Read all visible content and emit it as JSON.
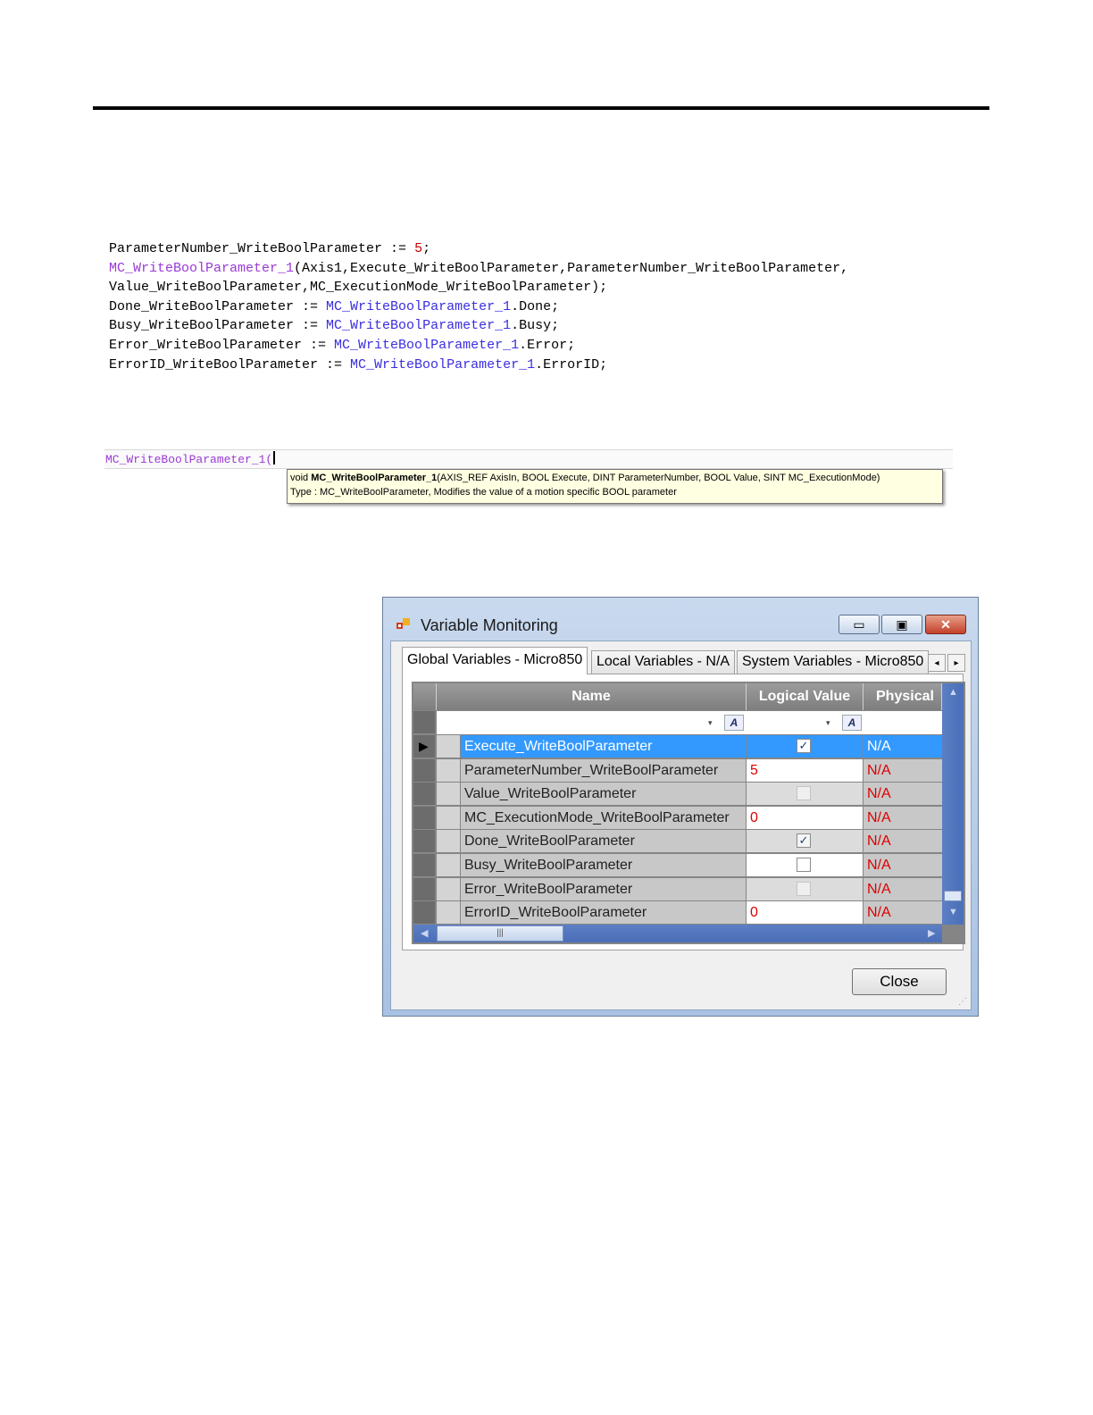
{
  "code": {
    "lines": [
      [
        {
          "t": "ParameterNumber_WriteBoolParameter := ",
          "c": ""
        },
        {
          "t": "5",
          "c": "red"
        },
        {
          "t": ";",
          "c": ""
        }
      ],
      [
        {
          "t": "MC_WriteBoolParameter_1",
          "c": "purple"
        },
        {
          "t": "(Axis1,Execute_WriteBoolParameter,ParameterNumber_WriteBoolParameter,",
          "c": ""
        }
      ],
      [
        {
          "t": "Value_WriteBoolParameter,MC_ExecutionMode_WriteBoolParameter);",
          "c": ""
        }
      ],
      [
        {
          "t": "Done_WriteBoolParameter := ",
          "c": ""
        },
        {
          "t": "MC_WriteBoolParameter_1",
          "c": "blue"
        },
        {
          "t": ".Done;",
          "c": ""
        }
      ],
      [
        {
          "t": "Busy_WriteBoolParameter := ",
          "c": ""
        },
        {
          "t": "MC_WriteBoolParameter_1",
          "c": "blue"
        },
        {
          "t": ".Busy;",
          "c": ""
        }
      ],
      [
        {
          "t": "Error_WriteBoolParameter := ",
          "c": ""
        },
        {
          "t": "MC_WriteBoolParameter_1",
          "c": "blue"
        },
        {
          "t": ".Error;",
          "c": ""
        }
      ],
      [
        {
          "t": "ErrorID_WriteBoolParameter := ",
          "c": ""
        },
        {
          "t": "MC_WriteBoolParameter_1",
          "c": "blue"
        },
        {
          "t": ".ErrorID;",
          "c": ""
        }
      ]
    ]
  },
  "intellisense": {
    "typed": "MC_WriteBoolParameter_1(",
    "tooltip_prefix": "void ",
    "tooltip_func": "MC_WriteBoolParameter_1",
    "tooltip_args": "(AXIS_REF AxisIn, BOOL Execute, DINT ParameterNumber, BOOL Value, SINT MC_ExecutionMode)",
    "tooltip_type": "Type : MC_WriteBoolParameter, Modifies the value of a motion specific BOOL parameter"
  },
  "window": {
    "title": "Variable Monitoring",
    "min_glyph": "▭",
    "max_glyph": "▣",
    "close_glyph": "✕",
    "tabs": [
      "Global Variables - Micro850",
      "Local Variables - N/A",
      "System Variables - Micro850"
    ],
    "tab_left_glyph": "◂",
    "tab_right_glyph": "▸",
    "columns": [
      "Name",
      "Logical Value",
      "Physical"
    ],
    "filter_glyph": "▾",
    "filter_icon_text": "A",
    "rows": [
      {
        "name": "Execute_WriteBoolParameter",
        "value": "",
        "check": "checked",
        "physical": "N/A"
      },
      {
        "name": "ParameterNumber_WriteBoolParameter",
        "value": "5",
        "check": "",
        "physical": "N/A"
      },
      {
        "name": "Value_WriteBoolParameter",
        "value": "",
        "check": "unchecked-dim",
        "physical": "N/A"
      },
      {
        "name": "MC_ExecutionMode_WriteBoolParameter",
        "value": "0",
        "check": "",
        "physical": "N/A"
      },
      {
        "name": "Done_WriteBoolParameter",
        "value": "",
        "check": "checked",
        "physical": "N/A"
      },
      {
        "name": "Busy_WriteBoolParameter",
        "value": "",
        "check": "unchecked",
        "physical": "N/A"
      },
      {
        "name": "Error_WriteBoolParameter",
        "value": "",
        "check": "unchecked-dim",
        "physical": "N/A"
      },
      {
        "name": "ErrorID_WriteBoolParameter",
        "value": "0",
        "check": "",
        "physical": "N/A"
      }
    ],
    "check_glyph": "✓",
    "current_row_glyph": "▶",
    "hscroll_thumb_glyph": "|||",
    "scroll_left_glyph": "◀",
    "scroll_right_glyph": "▶",
    "scroll_up_glyph": "▲",
    "scroll_down_glyph": "▼",
    "close_label": "Close",
    "grip_glyph": "⋰"
  }
}
